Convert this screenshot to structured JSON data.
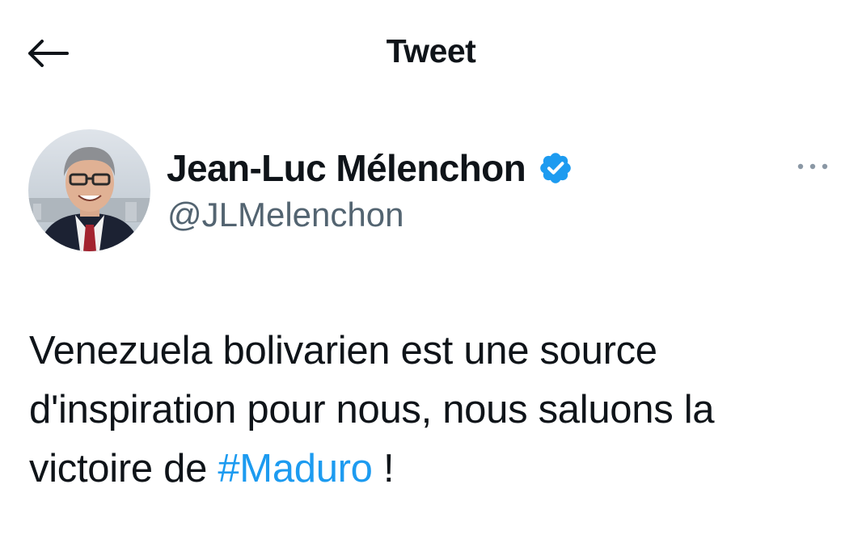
{
  "header": {
    "back_icon": "arrow-left-icon",
    "title": "Tweet"
  },
  "author": {
    "name": "Jean-Luc Mélenchon",
    "handle": "@JLMelenchon",
    "verified_icon": "verified-badge-icon",
    "verified_color": "#1d9bf0"
  },
  "more_icon": "more-horizontal-icon",
  "tweet": {
    "text_part1": "Venezuela bolivarien est une source d'inspiration pour nous, nous saluons la victoire de ",
    "hashtag": "#Maduro",
    "text_part2": " !"
  },
  "colors": {
    "text_primary": "#0f1419",
    "text_secondary": "#536471",
    "accent": "#1d9bf0"
  }
}
